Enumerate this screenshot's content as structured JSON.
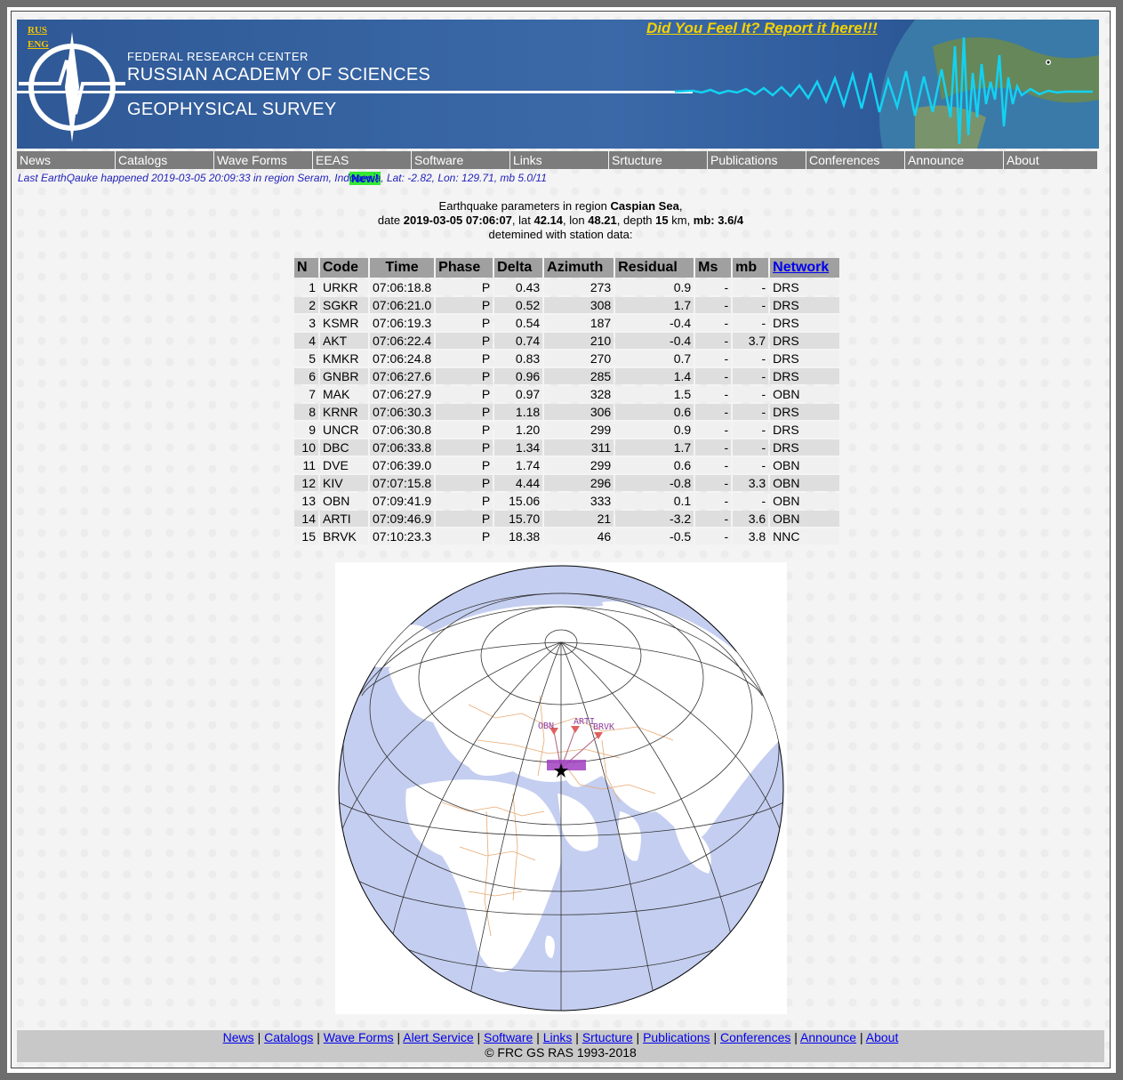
{
  "header": {
    "lang_rus": "RUS",
    "lang_eng": "ENG",
    "line1": "FEDERAL RESEARCH CENTER",
    "line2": "RUSSIAN ACADEMY OF SCIENCES",
    "line3": "GEOPHYSICAL SURVEY",
    "feel_link": "Did You Feel It? Report it here!!!"
  },
  "nav": {
    "items": [
      "News",
      "Catalogs",
      "Wave Forms",
      "EEAS",
      "Software",
      "Links",
      "Srtucture",
      "Publications",
      "Conferences",
      "Announce",
      "About"
    ],
    "new_badge": "New!"
  },
  "last_quake": "Last EarthQauke happened 2019-03-05 20:09:33 in region Seram, Indonesia, Lat: -2.82, Lon: 129.71, mb 5.0/11",
  "params": {
    "line1_prefix": "Earthquake parameters in region ",
    "region": "Caspian Sea",
    "line1_suffix": ",",
    "date_label": "date ",
    "date": "2019-03-05 07:06:07",
    "lat_label": ", lat ",
    "lat": "42.14",
    "lon_label": ", lon ",
    "lon": "48.21",
    "depth_label": ", depth ",
    "depth": "15",
    "depth_unit": " km, ",
    "mb_label": "mb: 3.6/4",
    "line3": "detemined with station data:"
  },
  "table": {
    "headers": [
      "N",
      "Code",
      "Time",
      "Phase",
      "Delta",
      "Azimuth",
      "Residual",
      "Ms",
      "mb",
      "Network"
    ],
    "rows": [
      [
        "1",
        "URKR",
        "07:06:18.8",
        "P",
        "0.43",
        "273",
        "0.9",
        "-",
        "-",
        "DRS"
      ],
      [
        "2",
        "SGKR",
        "07:06:21.0",
        "P",
        "0.52",
        "308",
        "1.7",
        "-",
        "-",
        "DRS"
      ],
      [
        "3",
        "KSMR",
        "07:06:19.3",
        "P",
        "0.54",
        "187",
        "-0.4",
        "-",
        "-",
        "DRS"
      ],
      [
        "4",
        "AKT",
        "07:06:22.4",
        "P",
        "0.74",
        "210",
        "-0.4",
        "-",
        "3.7",
        "DRS"
      ],
      [
        "5",
        "KMKR",
        "07:06:24.8",
        "P",
        "0.83",
        "270",
        "0.7",
        "-",
        "-",
        "DRS"
      ],
      [
        "6",
        "GNBR",
        "07:06:27.6",
        "P",
        "0.96",
        "285",
        "1.4",
        "-",
        "-",
        "DRS"
      ],
      [
        "7",
        "MAK",
        "07:06:27.9",
        "P",
        "0.97",
        "328",
        "1.5",
        "-",
        "-",
        "OBN"
      ],
      [
        "8",
        "KRNR",
        "07:06:30.3",
        "P",
        "1.18",
        "306",
        "0.6",
        "-",
        "-",
        "DRS"
      ],
      [
        "9",
        "UNCR",
        "07:06:30.8",
        "P",
        "1.20",
        "299",
        "0.9",
        "-",
        "-",
        "DRS"
      ],
      [
        "10",
        "DBC",
        "07:06:33.8",
        "P",
        "1.34",
        "311",
        "1.7",
        "-",
        "-",
        "DRS"
      ],
      [
        "11",
        "DVE",
        "07:06:39.0",
        "P",
        "1.74",
        "299",
        "0.6",
        "-",
        "-",
        "OBN"
      ],
      [
        "12",
        "KIV",
        "07:07:15.8",
        "P",
        "4.44",
        "296",
        "-0.8",
        "-",
        "3.3",
        "OBN"
      ],
      [
        "13",
        "OBN",
        "07:09:41.9",
        "P",
        "15.06",
        "333",
        "0.1",
        "-",
        "-",
        "OBN"
      ],
      [
        "14",
        "ARTI",
        "07:09:46.9",
        "P",
        "15.70",
        "21",
        "-3.2",
        "-",
        "3.6",
        "OBN"
      ],
      [
        "15",
        "BRVK",
        "07:10:23.3",
        "P",
        "18.38",
        "46",
        "-0.5",
        "-",
        "3.8",
        "NNC"
      ]
    ]
  },
  "map": {
    "stations": [
      "OBN",
      "ARTI",
      "BRVK"
    ],
    "ocean_color": "#c4cef0",
    "land_color": "#ffffff",
    "border_color": "#e8a870",
    "marker_color": "#e06060"
  },
  "footer": {
    "links": [
      "News",
      "Catalogs",
      "Wave Forms",
      "Alert Service",
      "Software",
      "Links",
      "Srtucture",
      "Publications",
      "Conferences",
      "Announce",
      "About"
    ],
    "separator": "|",
    "copyright": "© FRC GS RAS 1993-2018"
  },
  "colors": {
    "banner_blue": "#3b69a8",
    "nav_gray": "#7c7c7c",
    "link_blue": "#0000ee",
    "accent_yellow": "#f5d200",
    "wave_cyan": "#12d2f2"
  }
}
